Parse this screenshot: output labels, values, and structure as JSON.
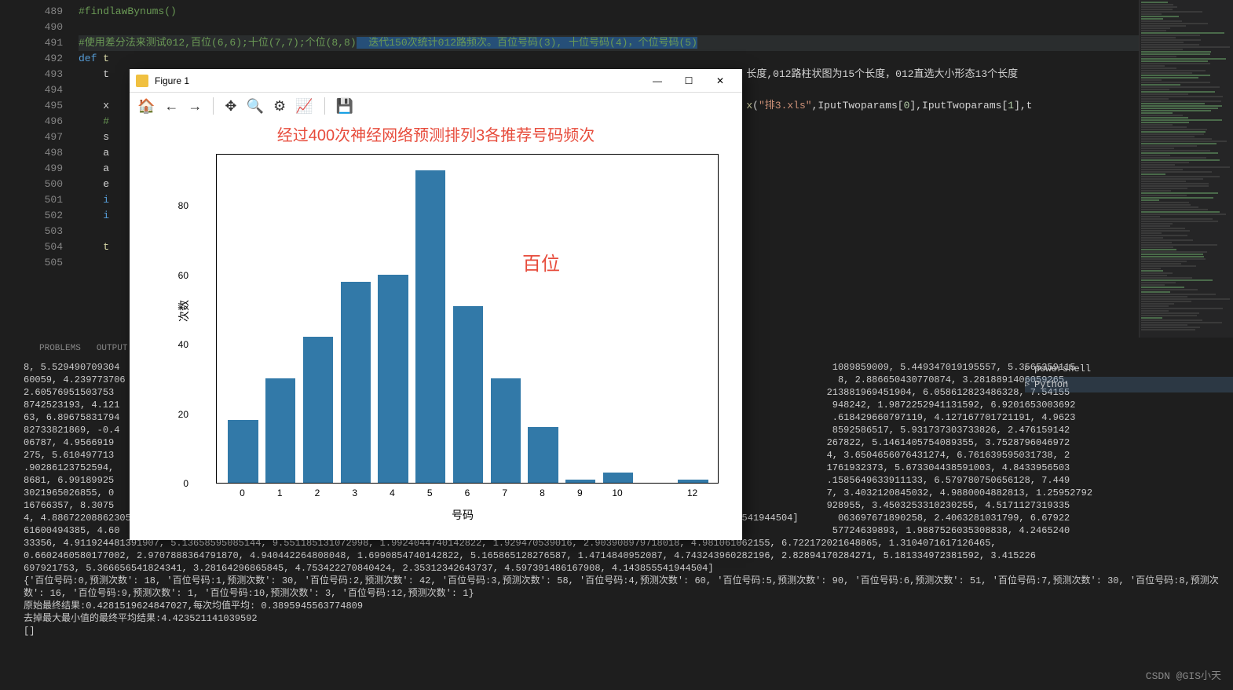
{
  "editor": {
    "lines": [
      {
        "num": 489,
        "html": "<span class='comment'>#findlawBynums()</span>"
      },
      {
        "num": 490,
        "html": ""
      },
      {
        "num": 491,
        "html": "<span class='comment'>#使用差分法来测试012,百位(6,6);十位(7,7);个位(8,8)</span><span class='highlight-sel'><span class='comment'>  迭代150次统计012路频次。百位号码(3), 十位号码(4)，个位号码(5)</span></span>"
      },
      {
        "num": 492,
        "html": "<span class='keyword'>def</span> <span class='func'>t</span>"
      },
      {
        "num": 493,
        "html": "    t                                                                                                        <span style='color:#d4d4d4'>长度,012路柱状图为15个长度，012直选大小形态13个长度</span>"
      },
      {
        "num": 494,
        "html": "    "
      },
      {
        "num": 495,
        "html": "    x                                                                                                        <span style='color:#dcdcaa'>x</span>(<span class='string'>\"排3.xls\"</span>,IputTwoparams[<span class='number'>0</span>],IputTwoparams[<span class='number'>1</span>],t"
      },
      {
        "num": 496,
        "html": "    <span class='comment'>#</span>"
      },
      {
        "num": 497,
        "html": "    s"
      },
      {
        "num": 498,
        "html": "    a"
      },
      {
        "num": 499,
        "html": "    a"
      },
      {
        "num": 500,
        "html": "    e"
      },
      {
        "num": 501,
        "html": "    <span class='keyword'>i</span>"
      },
      {
        "num": 502,
        "html": "    <span class='keyword'>i</span>"
      },
      {
        "num": 503,
        "html": ""
      },
      {
        "num": 504,
        "html": "    <span class='func'>t</span>"
      },
      {
        "num": 505,
        "html": ""
      }
    ]
  },
  "panel_tabs": [
    "PROBLEMS",
    "OUTPUT"
  ],
  "right_panel": {
    "items": [
      {
        "label": "powershell",
        "active": false
      },
      {
        "label": "Python",
        "active": true
      }
    ]
  },
  "terminal_text": "8, 5.529490709304                                                                                                                              1089859009, 5.449347019195557, 5.3565359115\n60059, 4.239773706                                                                                                                              8, 2.886650430770874, 3.2818891406059265,\n2.60576951503753                                                                                                                              213881969451904, 6.058612823486328, 7.54155\n8742523193, 4.121                                                                                                                              948242, 1.9872252941131592, 6.9201653003692\n63, 6.89675831794                                                                                                                              .618429660797119, 4.127167701721191, 4.9623\n82733821869, -0.4                                                                                                                              8592586517, 5.931737303733826, 2.476159142\n06787, 4.9566919                                                                                                                              267822, 5.1461405754089355, 3.7528796046972\n275, 5.610497713                                                                                                                              4, 3.6504656076431274, 6.761639595031738, 2\n.90286123752594,                                                                                                                              1761932373, 5.673304438591003, 4.8433956503\n8681, 6.99189925                                                                                                                              .1585649633911133, 6.579780750656128, 7.449\n3021965026855, 0                                                                                                                              7, 3.4032120845032, 4.9880004882813, 1.25952792\n16766357, 8.3075                                                                                                                              928955, 3.4503253310230255, 4.5171127319335\n4, 4.88672208862305, 4.168580204546585846, 1.821742129325866, 2.4598622274780424, 2.35312342643737, 4.597391486167908, 4.143855541944504]       063697671890258, 2.4063281031799, 6.67922\n61600494385, 4.60                                                                                                                              57724639893, 1.9887526035308838, 4.2465240\n33356, 4.911924481391907, 5.13658595085144, 9.551185131072998, 1.9924044740142822, 1.929470539016, 2.903908979718018, 4.981061062155, 6.722172021648865, 1.3104071617126465,\n0.6602460580177002, 2.9707888364791870, 4.940442264808048, 1.6990854740142822, 5.165865128276587, 1.4714840952087, 4.743243960282196, 2.82894170284271, 5.181334972381592, 3.415226\n697921753, 5.366656541824341, 3.28164296865845, 4.753422270840424, 2.35312342643737, 4.597391486167908, 4.143855541944504]\n{'百位号码:0,预测次数': 18, '百位号码:1,预测次数': 30, '百位号码:2,预测次数': 42, '百位号码:3,预测次数': 58, '百位号码:4,预测次数': 60, '百位号码:5,预测次数': 90, '百位号码:6,预测次数': 51, '百位号码:7,预测次数': 30, '百位号码:8,预测次数': 16, '百位号码:9,预测次数': 1, '百位号码:10,预测次数': 3, '百位号码:12,预测次数': 1}\n原始最终结果:0.4281519624847027,每次均值平均: 0.3895945563774809\n去掉最大最小值的最终平均结果:4.423521141039592\n[]",
  "watermark": "CSDN @GIS小天",
  "figure": {
    "title": "Figure 1",
    "toolbar": [
      "home",
      "back",
      "forward",
      "|",
      "pan",
      "zoom",
      "config",
      "axes",
      "|",
      "save"
    ]
  },
  "chart_data": {
    "type": "bar",
    "title": "经过400次神经网络预测排列3各推荐号码频次",
    "xlabel": "号码",
    "ylabel": "次数",
    "annotation": "百位",
    "categories": [
      0,
      1,
      2,
      3,
      4,
      5,
      6,
      7,
      8,
      9,
      10,
      12
    ],
    "values": [
      18,
      30,
      42,
      58,
      60,
      90,
      51,
      30,
      16,
      1,
      3,
      1
    ],
    "yticks": [
      0,
      20,
      40,
      60,
      80
    ],
    "ylim": [
      0,
      95
    ]
  }
}
